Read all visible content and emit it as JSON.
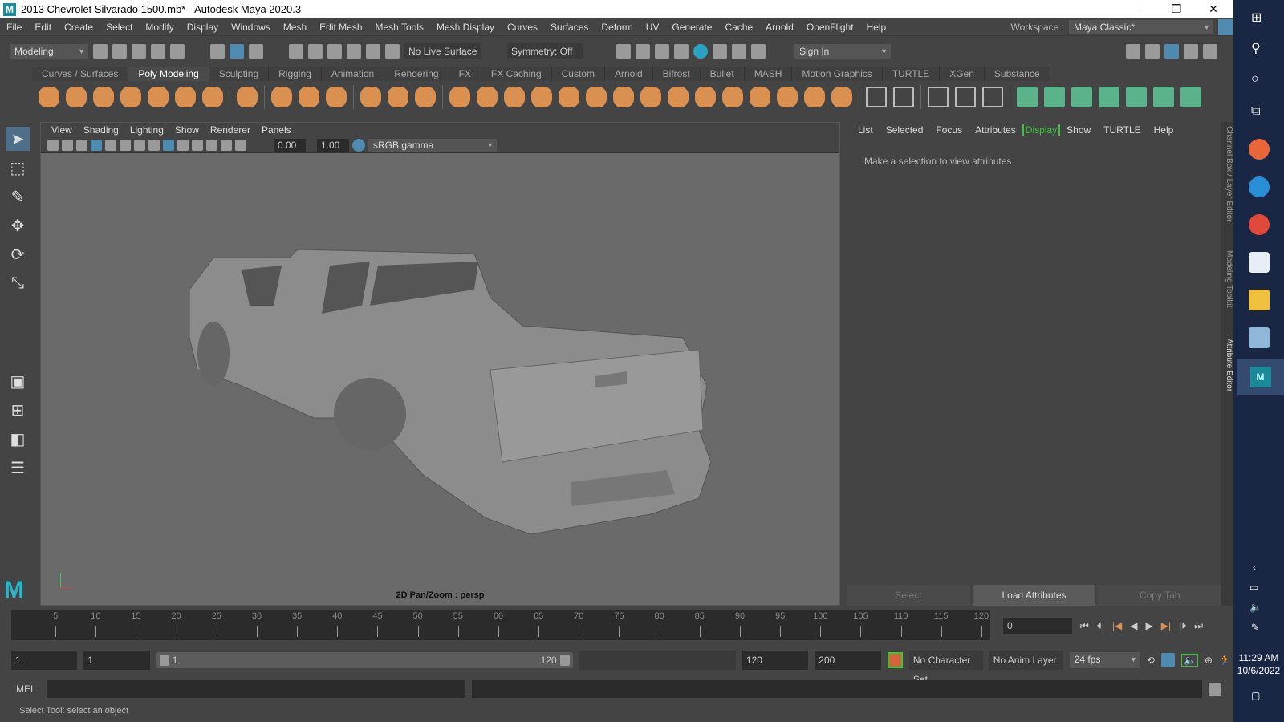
{
  "window": {
    "title": "2013 Chevrolet Silvarado 1500.mb* - Autodesk Maya 2020.3",
    "logo": "M",
    "min": "–",
    "max": "❐",
    "close": "✕"
  },
  "menus": [
    "File",
    "Edit",
    "Create",
    "Select",
    "Modify",
    "Display",
    "Windows",
    "Mesh",
    "Edit Mesh",
    "Mesh Tools",
    "Mesh Display",
    "Curves",
    "Surfaces",
    "Deform",
    "UV",
    "Generate",
    "Cache",
    "Arnold",
    "OpenFlight",
    "Help"
  ],
  "workspace": {
    "label": "Workspace :",
    "value": "Maya Classic*"
  },
  "status": {
    "mode": "Modeling",
    "live_surface": "No Live Surface",
    "symmetry": "Symmetry: Off",
    "sign_in": "Sign In"
  },
  "shelf_tabs": [
    "Curves / Surfaces",
    "Poly Modeling",
    "Sculpting",
    "Rigging",
    "Animation",
    "Rendering",
    "FX",
    "FX Caching",
    "Custom",
    "Arnold",
    "Bifrost",
    "Bullet",
    "MASH",
    "Motion Graphics",
    "TURTLE",
    "XGen",
    "Substance"
  ],
  "shelf_active": "Poly Modeling",
  "viewport": {
    "menus": [
      "View",
      "Shading",
      "Lighting",
      "Show",
      "Renderer",
      "Panels"
    ],
    "exposure": "0.00",
    "gamma": "1.00",
    "color_space": "sRGB gamma",
    "camera_label": "2D Pan/Zoom : persp"
  },
  "attr": {
    "menus": [
      "List",
      "Selected",
      "Focus",
      "Attributes",
      "Display",
      "Show",
      "TURTLE",
      "Help"
    ],
    "message": "Make a selection to view attributes",
    "buttons": [
      "Select",
      "Load Attributes",
      "Copy Tab"
    ]
  },
  "side_tabs": [
    "Channel Box / Layer Editor",
    "Modeling Toolkit",
    "Attribute Editor"
  ],
  "timeline": {
    "ticks": [
      5,
      10,
      15,
      20,
      25,
      30,
      35,
      40,
      45,
      50,
      55,
      60,
      65,
      70,
      75,
      80,
      85,
      90,
      95,
      100,
      105,
      110,
      115,
      120
    ],
    "current_frame": "0"
  },
  "range": {
    "start": "1",
    "anim_start": "1",
    "slider_start": "1",
    "slider_end": "120",
    "end": "120",
    "anim_end": "200",
    "character_set": "No Character Set",
    "anim_layer": "No Anim Layer",
    "fps": "24 fps"
  },
  "command": {
    "label": "MEL"
  },
  "help_line": "Select Tool: select an object",
  "clock": {
    "time": "11:29 AM",
    "date": "10/6/2022"
  },
  "colors": {
    "accent": "#4f8ab0",
    "shelf_icon": "#d99050",
    "display_green": "#39c639"
  }
}
